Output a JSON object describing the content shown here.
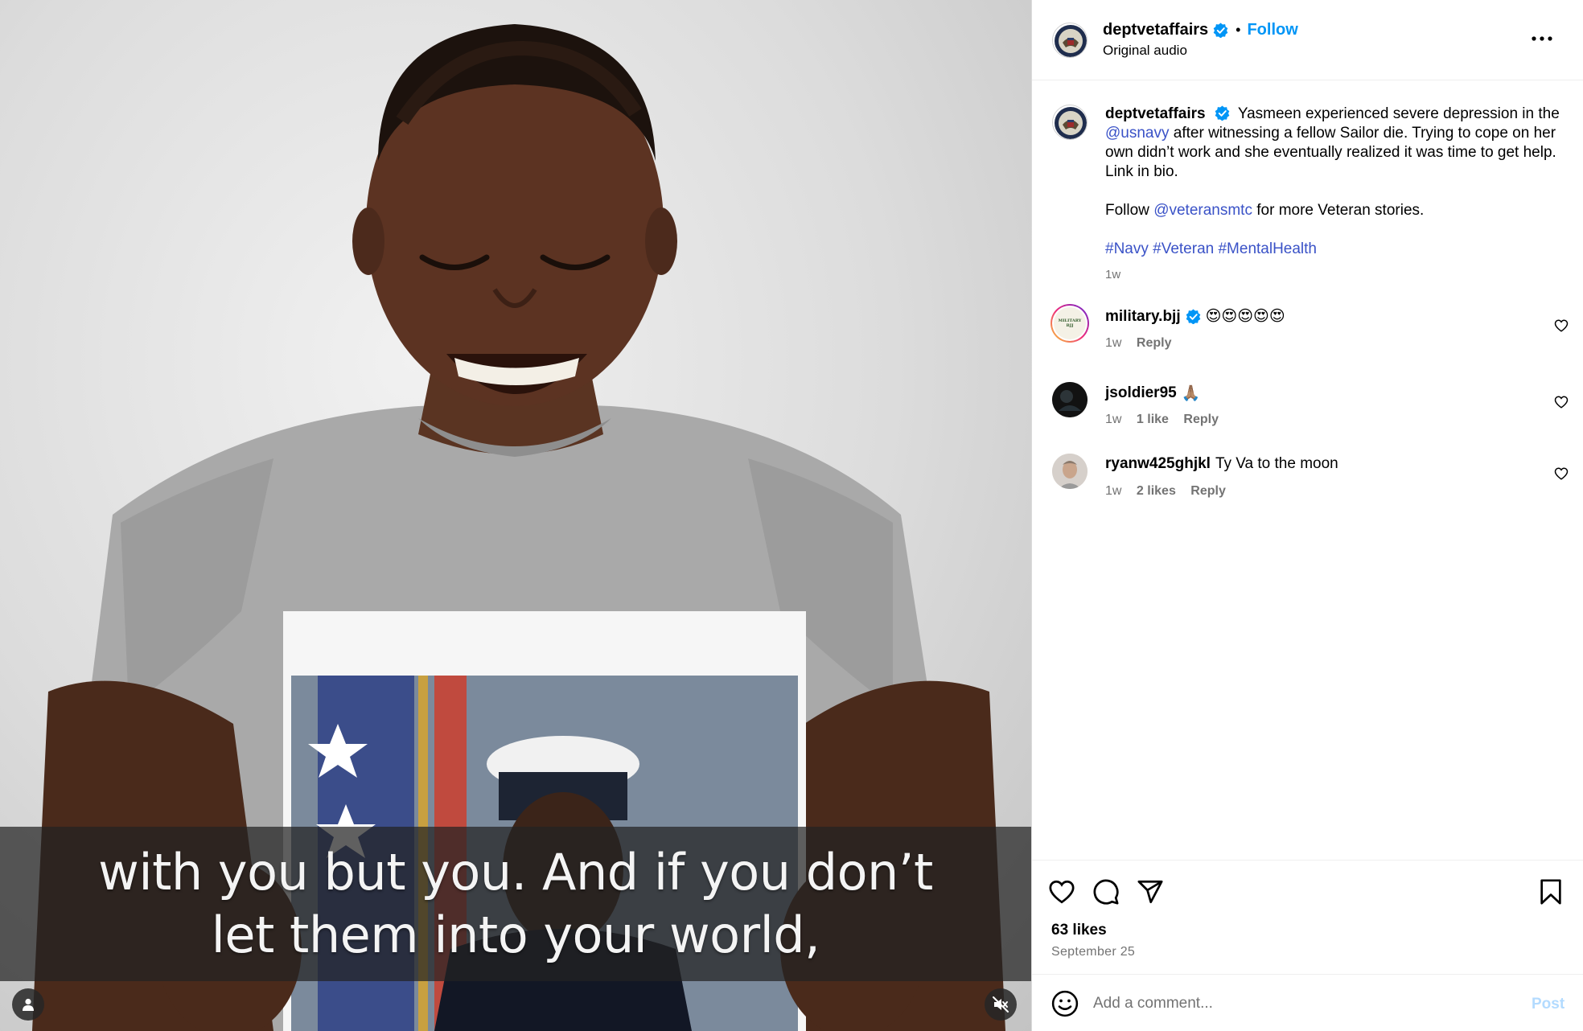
{
  "media": {
    "subtitle_lines": [
      "with you but you. And if you don’t",
      "let them into your world,"
    ]
  },
  "header": {
    "username": "deptvetaffairs",
    "separator": "•",
    "follow_label": "Follow",
    "audio_label": "Original audio"
  },
  "caption": {
    "username": "deptvetaffairs",
    "text_before_mention": "Yasmeen experienced severe depression in the",
    "mention_1": "@usnavy",
    "text_after_mention": "after witnessing a fellow Sailor die. Trying to cope on her own didn’t work and she eventually realized it was time to get help. Link in bio.",
    "follow_prefix": "Follow",
    "mention_2": "@veteransmtc",
    "follow_suffix": "for more Veteran stories.",
    "hashtags": "#Navy #Veteran #MentalHealth",
    "time": "1w"
  },
  "comments": [
    {
      "username": "military.bjj",
      "verified": true,
      "text": "😍😍😍😍😍",
      "time": "1w",
      "likes": "",
      "reply_label": "Reply",
      "avatar_label": "MILITARY BJJ"
    },
    {
      "username": "jsoldier95",
      "verified": false,
      "text": "🙏🏽",
      "time": "1w",
      "likes": "1 like",
      "reply_label": "Reply"
    },
    {
      "username": "ryanw425ghjkl",
      "verified": false,
      "text": "Ty Va to the moon",
      "time": "1w",
      "likes": "2 likes",
      "reply_label": "Reply"
    }
  ],
  "stats": {
    "likes": "63 likes",
    "date": "September 25"
  },
  "comment_box": {
    "placeholder": "Add a comment...",
    "post_label": "Post"
  },
  "colors": {
    "link_blue": "#0095f6",
    "mention_blue": "#3a52c7",
    "post_disabled": "#b3dbff",
    "meta_gray": "#737373"
  },
  "icons": [
    "heart-icon",
    "comment-icon",
    "share-icon",
    "bookmark-icon",
    "emoji-icon",
    "more-icon",
    "verified-icon",
    "user-tag-icon",
    "muted-speaker-icon"
  ]
}
